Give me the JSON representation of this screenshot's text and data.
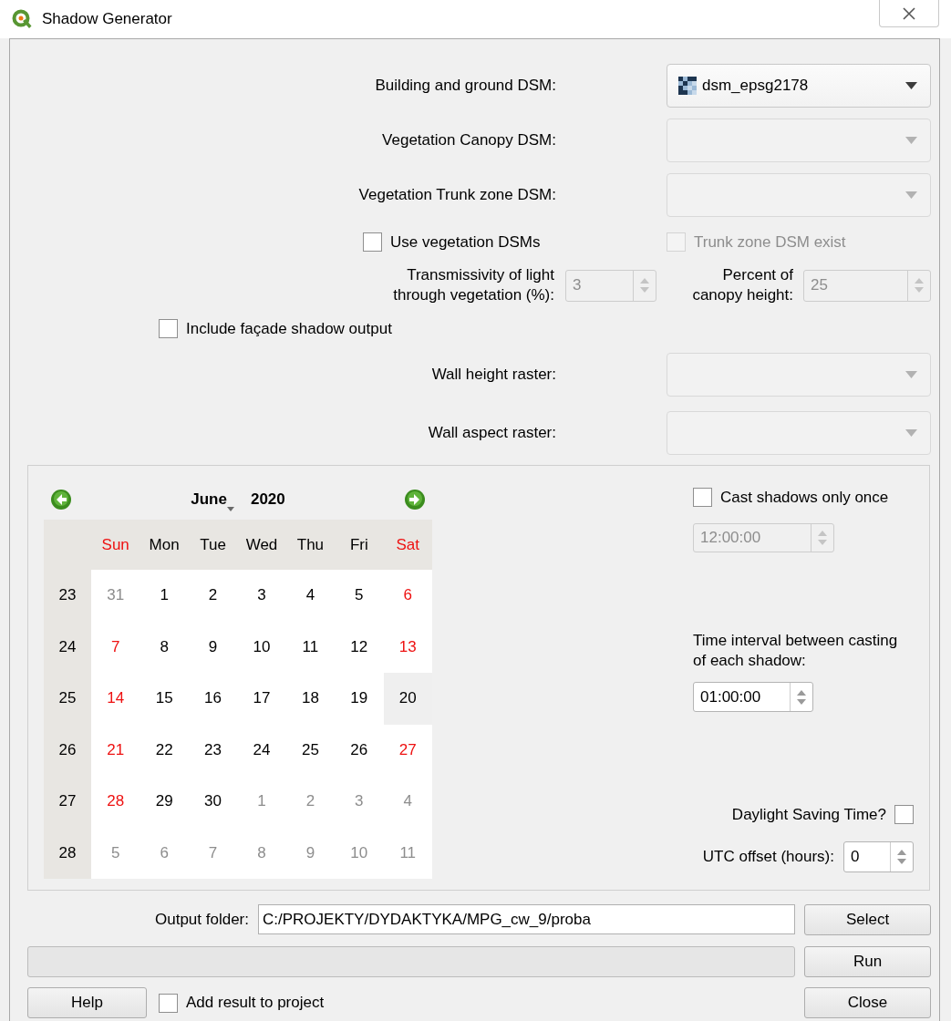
{
  "window": {
    "title": "Shadow Generator"
  },
  "layer_inputs": [
    {
      "label": "Building and ground DSM:",
      "value": "dsm_epsg2178",
      "disabled": false
    },
    {
      "label": "Vegetation Canopy DSM:",
      "disabled": true
    },
    {
      "label": "Vegetation Trunk zone DSM:",
      "disabled": true
    }
  ],
  "use_vegetation": {
    "label": "Use vegetation DSMs",
    "checked": false,
    "disabled": false
  },
  "trunk_exist": {
    "label": "Trunk zone DSM exist",
    "checked": false,
    "disabled": true
  },
  "transmissivity": {
    "label": "Transmissivity of light through vegetation (%):",
    "value": "3",
    "disabled": true
  },
  "canopy_percent": {
    "label": "Percent of canopy height:",
    "value": "25",
    "disabled": true
  },
  "facade": {
    "label": "Include façade shadow output",
    "checked": false
  },
  "wall_inputs": [
    {
      "label": "Wall height raster:",
      "disabled": true
    },
    {
      "label": "Wall aspect raster:",
      "disabled": true
    }
  ],
  "calendar": {
    "month": "June",
    "year": "2020",
    "weekdays": [
      {
        "label": "Sun",
        "weekend": true
      },
      {
        "label": "Mon",
        "weekend": false
      },
      {
        "label": "Tue",
        "weekend": false
      },
      {
        "label": "Wed",
        "weekend": false
      },
      {
        "label": "Thu",
        "weekend": false
      },
      {
        "label": "Fri",
        "weekend": false
      },
      {
        "label": "Sat",
        "weekend": true
      }
    ],
    "weeks": [
      {
        "number": "23",
        "days": [
          {
            "day": "31",
            "other_month": true,
            "selected": false
          },
          {
            "day": "1",
            "other_month": false,
            "selected": false
          },
          {
            "day": "2",
            "other_month": false,
            "selected": false
          },
          {
            "day": "3",
            "other_month": false,
            "selected": false
          },
          {
            "day": "4",
            "other_month": false,
            "selected": false
          },
          {
            "day": "5",
            "other_month": false,
            "selected": false
          },
          {
            "day": "6",
            "other_month": false,
            "selected": false
          }
        ]
      },
      {
        "number": "24",
        "days": [
          {
            "day": "7",
            "other_month": false,
            "selected": false
          },
          {
            "day": "8",
            "other_month": false,
            "selected": false
          },
          {
            "day": "9",
            "other_month": false,
            "selected": false
          },
          {
            "day": "10",
            "other_month": false,
            "selected": false
          },
          {
            "day": "11",
            "other_month": false,
            "selected": false
          },
          {
            "day": "12",
            "other_month": false,
            "selected": false
          },
          {
            "day": "13",
            "other_month": false,
            "selected": false
          }
        ]
      },
      {
        "number": "25",
        "days": [
          {
            "day": "14",
            "other_month": false,
            "selected": false
          },
          {
            "day": "15",
            "other_month": false,
            "selected": false
          },
          {
            "day": "16",
            "other_month": false,
            "selected": false
          },
          {
            "day": "17",
            "other_month": false,
            "selected": false
          },
          {
            "day": "18",
            "other_month": false,
            "selected": false
          },
          {
            "day": "19",
            "other_month": false,
            "selected": false
          },
          {
            "day": "20",
            "other_month": false,
            "selected": true
          }
        ]
      },
      {
        "number": "26",
        "days": [
          {
            "day": "21",
            "other_month": false,
            "selected": false
          },
          {
            "day": "22",
            "other_month": false,
            "selected": false
          },
          {
            "day": "23",
            "other_month": false,
            "selected": false
          },
          {
            "day": "24",
            "other_month": false,
            "selected": false
          },
          {
            "day": "25",
            "other_month": false,
            "selected": false
          },
          {
            "day": "26",
            "other_month": false,
            "selected": false
          },
          {
            "day": "27",
            "other_month": false,
            "selected": false
          }
        ]
      },
      {
        "number": "27",
        "days": [
          {
            "day": "28",
            "other_month": false,
            "selected": false
          },
          {
            "day": "29",
            "other_month": false,
            "selected": false
          },
          {
            "day": "30",
            "other_month": false,
            "selected": false
          },
          {
            "day": "1",
            "other_month": true,
            "selected": false
          },
          {
            "day": "2",
            "other_month": true,
            "selected": false
          },
          {
            "day": "3",
            "other_month": true,
            "selected": false
          },
          {
            "day": "4",
            "other_month": true,
            "selected": false
          }
        ]
      },
      {
        "number": "28",
        "days": [
          {
            "day": "5",
            "other_month": true,
            "selected": false
          },
          {
            "day": "6",
            "other_month": true,
            "selected": false
          },
          {
            "day": "7",
            "other_month": true,
            "selected": false
          },
          {
            "day": "8",
            "other_month": true,
            "selected": false
          },
          {
            "day": "9",
            "other_month": true,
            "selected": false
          },
          {
            "day": "10",
            "other_month": true,
            "selected": false
          },
          {
            "day": "11",
            "other_month": true,
            "selected": false
          }
        ]
      }
    ]
  },
  "cast_once": {
    "label": "Cast shadows only once",
    "checked": false
  },
  "cast_time": {
    "value": "12:00:00",
    "disabled": true
  },
  "interval": {
    "label": "Time interval between casting of each shadow:",
    "value": "01:00:00",
    "disabled": false
  },
  "dst": {
    "label": "Daylight Saving Time?",
    "checked": false
  },
  "utc": {
    "label": "UTC offset (hours):",
    "value": "0"
  },
  "output": {
    "label": "Output folder:",
    "value": "C:/PROJEKTY/DYDAKTYKA/MPG_cw_9/proba",
    "button": "Select"
  },
  "progress": {
    "level": 0
  },
  "run_button": "Run",
  "help_button": "Help",
  "add_result": {
    "label": "Add result to project",
    "checked": false
  },
  "close_button": "Close"
}
